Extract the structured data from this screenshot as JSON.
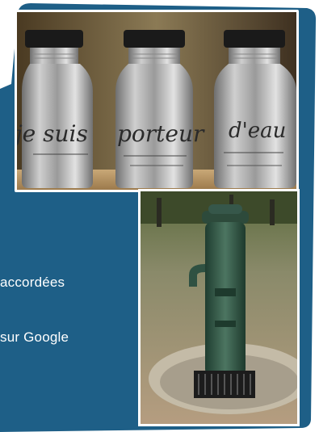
{
  "text": {
    "line_1": "accordées",
    "line_2": "sur Google"
  },
  "bottle_labels": {
    "left": "je suis",
    "middle": "porteur",
    "right": "d'eau"
  },
  "colors": {
    "panel": "#1e5f87",
    "text": "#ffffff",
    "frame": "#ffffff"
  },
  "photos": [
    {
      "name": "bottles-photo",
      "subject": "three stainless steel water bottles"
    },
    {
      "name": "fountain-photo",
      "subject": "green public water fountain in a park"
    }
  ]
}
